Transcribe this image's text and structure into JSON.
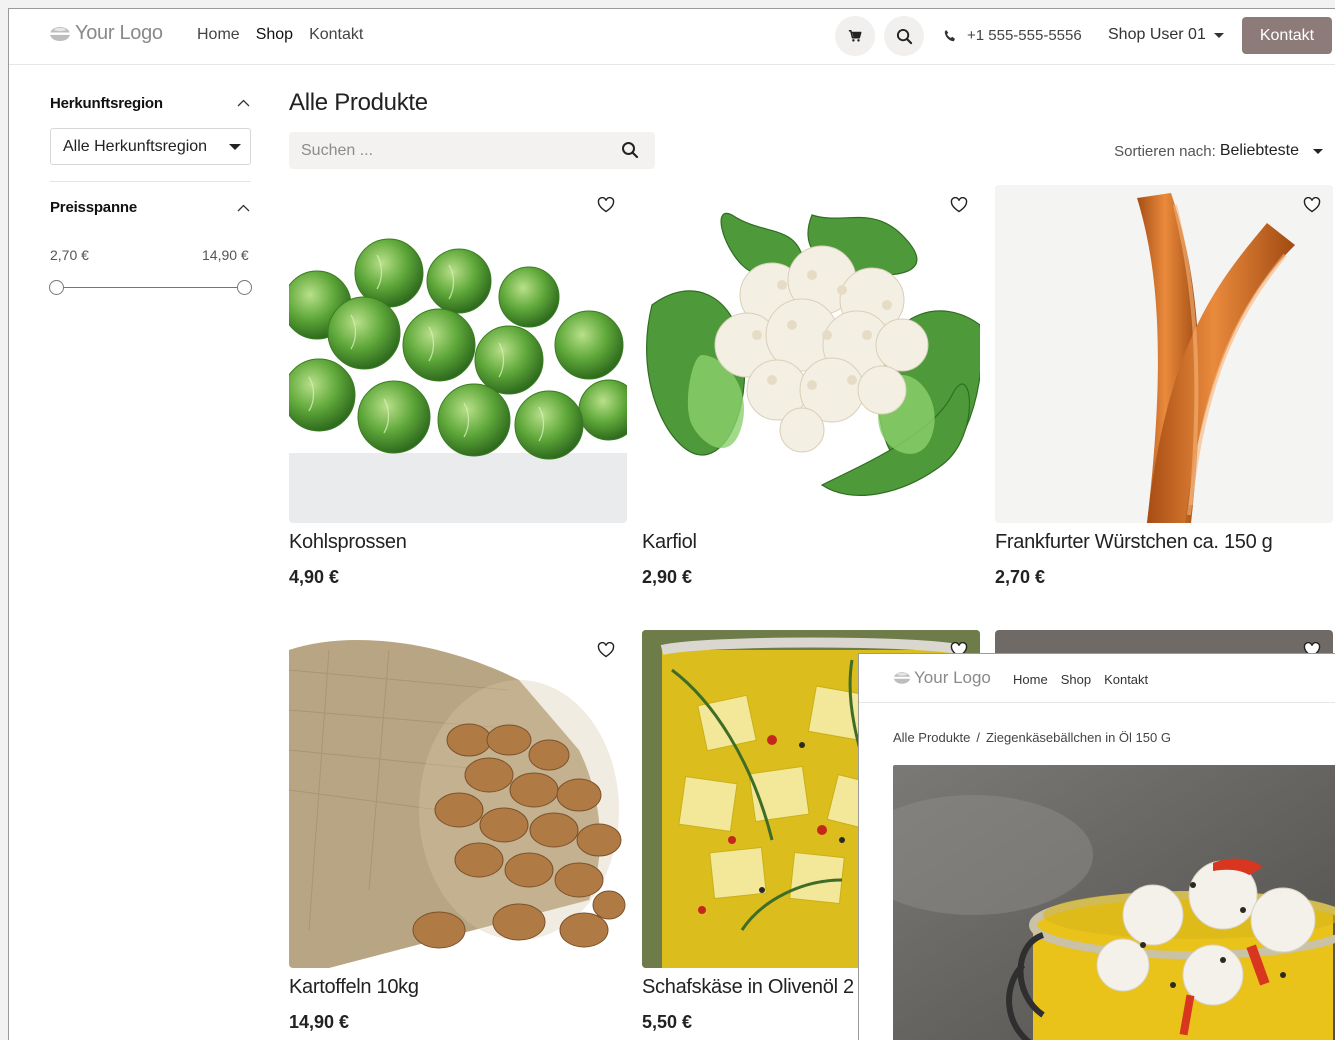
{
  "header": {
    "logo_text": "Your Logo",
    "nav": [
      "Home",
      "Shop",
      "Kontakt"
    ],
    "active_nav": "Shop",
    "phone": "+1 555-555-5556",
    "user": "Shop User 01",
    "contact_button": "Kontakt"
  },
  "sidebar": {
    "region_title": "Herkunftsregion",
    "region_select": "Alle Herkunftsregion",
    "price_title": "Preisspanne",
    "price_min": "2,70 €",
    "price_max": "14,90 €",
    "slider_range": [
      0,
      1
    ]
  },
  "main": {
    "title": "Alle Produkte",
    "search_placeholder": "Suchen ...",
    "sort_label": "Sortieren nach:",
    "sort_value": "Beliebteste",
    "products": [
      {
        "name": "Kohlsprossen",
        "price": "4,90 €"
      },
      {
        "name": "Karfiol",
        "price": "2,90 €"
      },
      {
        "name": "Frankfurter Würstchen ca. 150 g",
        "price": "2,70 €"
      },
      {
        "name": "Kartoffeln 10kg",
        "price": "14,90 €"
      },
      {
        "name": "Schafskäse in Olivenöl 2",
        "price": "5,50 €"
      }
    ]
  },
  "overlay": {
    "logo_text": "Your Logo",
    "nav": [
      "Home",
      "Shop",
      "Kontakt"
    ],
    "breadcrumb_root": "Alle Produkte",
    "breadcrumb_sep": "/",
    "breadcrumb_current": "Ziegenkäsebällchen in Öl 150 G"
  },
  "colors": {
    "accent": "#8c7b79",
    "search_bg": "#f3f2f0"
  }
}
